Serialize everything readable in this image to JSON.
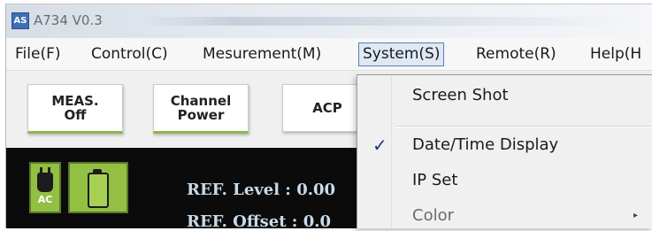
{
  "window": {
    "title": "A734 V0.3",
    "icon_text": "AS"
  },
  "menubar": {
    "items": [
      {
        "label": "File(F)"
      },
      {
        "label": "Control(C)"
      },
      {
        "label": "Mesurement(M)"
      },
      {
        "label": "System(S)",
        "active": true
      },
      {
        "label": "Remote(R)"
      },
      {
        "label": "Help(H"
      }
    ]
  },
  "toolbar": {
    "buttons": [
      {
        "label": "MEAS.\nOff"
      },
      {
        "label": "Channel\nPower"
      },
      {
        "label": "ACP"
      }
    ]
  },
  "display": {
    "ac_label": "AC",
    "readouts": [
      "REF. Level :  0.00",
      "REF. Offset :  0.0"
    ],
    "colors": {
      "background": "#0b0b0b",
      "indicator": "#93c043",
      "text": "#c8dbea"
    }
  },
  "system_menu": {
    "items": [
      {
        "label": "Screen Shot",
        "checked": false
      },
      {
        "label": "Date/Time Display",
        "checked": true,
        "check_mark": "✓"
      },
      {
        "label": "IP Set",
        "checked": false
      },
      {
        "label": "Color",
        "submenu": true,
        "arrow": "▸"
      }
    ]
  }
}
